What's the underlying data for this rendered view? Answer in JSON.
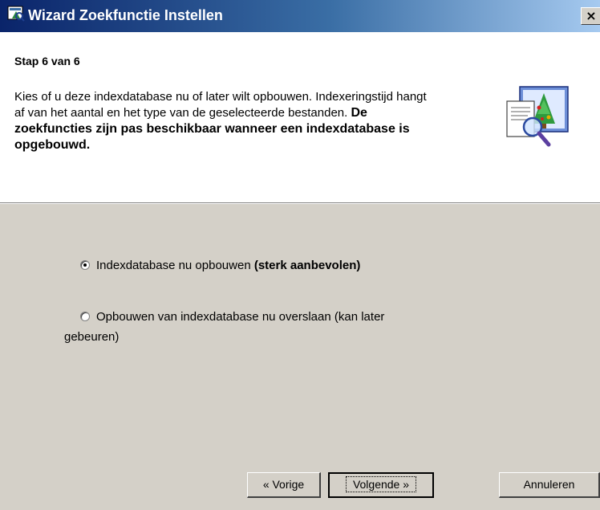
{
  "window": {
    "title": "Wizard Zoekfunctie Instellen",
    "close_symbol": "×",
    "icon": "wizard-app-icon"
  },
  "header": {
    "step": "Stap 6 van 6",
    "description_regular": "Kies of u deze indexdatabase nu of later wilt opbouwen. Indexeringstijd hangt af van het aantal en het type van de geselecteerde bestanden.",
    "description_bold": "De zoekfuncties zijn pas beschikbaar wanneer een indexdatabase is opgebouwd.",
    "illustration": "search-index-wizard-illustration"
  },
  "options": [
    {
      "label": "Indexdatabase nu opbouwen",
      "label_bold": "(sterk aanbevolen)",
      "checked": true
    },
    {
      "label": "Opbouwen van indexdatabase nu overslaan (kan later",
      "label_line2": "gebeuren)",
      "checked": false
    }
  ],
  "buttons": {
    "back": "« Vorige",
    "next": "Volgende »",
    "cancel": "Annuleren"
  }
}
